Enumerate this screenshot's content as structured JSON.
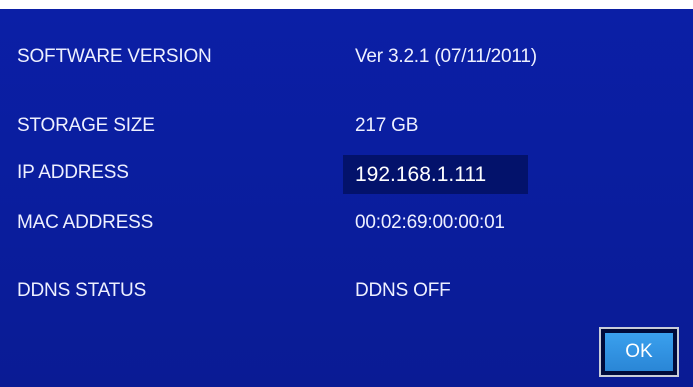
{
  "info_rows": [
    {
      "label": "SOFTWARE VERSION",
      "value": "Ver 3.2.1 (07/11/2011)"
    },
    {
      "label": "STORAGE SIZE",
      "value": "217 GB"
    },
    {
      "label": "IP ADDRESS",
      "value": "192.168.1.111"
    },
    {
      "label": "MAC ADDRESS",
      "value": "00:02:69:00:00:01"
    },
    {
      "label": "DDNS STATUS",
      "value": "DDNS OFF"
    }
  ],
  "ok_button": {
    "label": "OK"
  },
  "colors": {
    "background": "#0b1fa6",
    "highlight_background": "#03126b",
    "button": "#2d8fe0",
    "text": "#eef0ff"
  }
}
